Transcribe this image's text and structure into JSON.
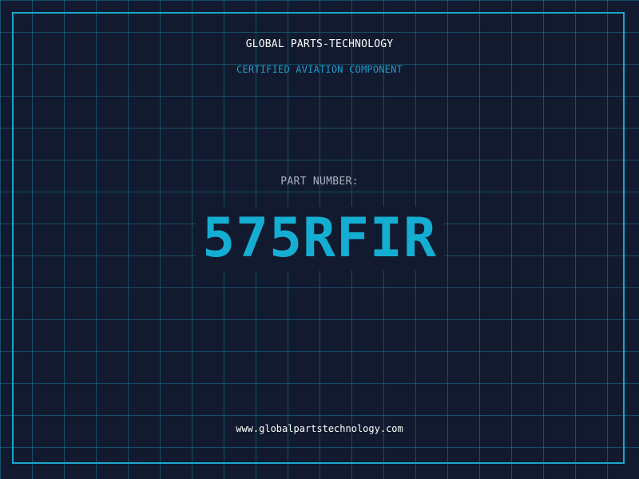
{
  "header": {
    "company": "GLOBAL PARTS-TECHNOLOGY",
    "tagline": "CERTIFIED AVIATION COMPONENT"
  },
  "part": {
    "label": "PART NUMBER:",
    "number": "575RFIR"
  },
  "footer": {
    "url": "www.globalpartstechnology.com"
  },
  "colors": {
    "background": "#111a2e",
    "grid": "#1b7896",
    "accent": "#14aed3",
    "frame": "#1aa6cf"
  }
}
